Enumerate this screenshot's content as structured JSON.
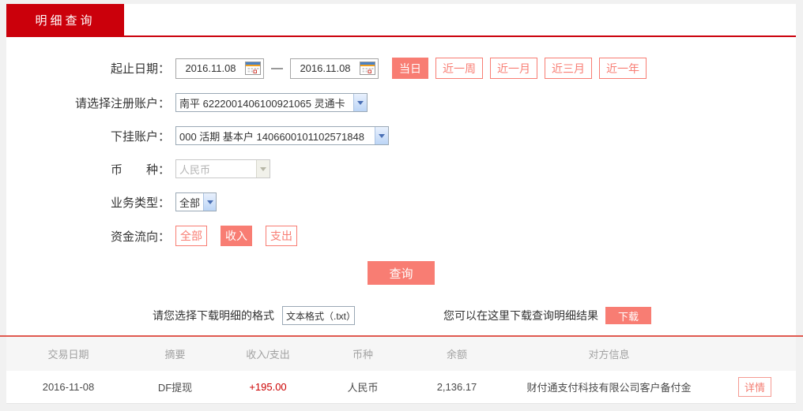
{
  "tab": {
    "label": "明细查询"
  },
  "form": {
    "date_range": {
      "label": "起止日期：",
      "start_value": "2016.11.08",
      "end_value": "2016.11.08",
      "separator": "—",
      "quick_ranges": [
        {
          "label": "当日",
          "selected": true
        },
        {
          "label": "近一周",
          "selected": false
        },
        {
          "label": "近一月",
          "selected": false
        },
        {
          "label": "近三月",
          "selected": false
        },
        {
          "label": "近一年",
          "selected": false
        }
      ]
    },
    "register_account": {
      "label": "请选择注册账户：",
      "selected_value": "南平 6222001406100921065 灵通卡"
    },
    "linked_account": {
      "label": "下挂账户：",
      "selected_value": "000 活期 基本户 1406600101102571848"
    },
    "currency": {
      "label": "币　　种：",
      "selected_value": "人民币",
      "disabled": true
    },
    "business_type": {
      "label": "业务类型：",
      "selected_value": "全部"
    },
    "fund_flow": {
      "label": "资金流向：",
      "options": [
        {
          "label": "全部",
          "selected": false
        },
        {
          "label": "收入",
          "selected": true
        },
        {
          "label": "支出",
          "selected": false
        }
      ]
    },
    "query_button_label": "查询"
  },
  "download": {
    "format_label": "请您选择下载明细的格式",
    "format_value": "文本格式（.txt）",
    "hint_text": "您可以在这里下载查询明细结果",
    "download_button_label": "下载"
  },
  "table": {
    "headers": [
      "交易日期",
      "摘要",
      "收入/支出",
      "币种",
      "余额",
      "对方信息"
    ],
    "rows": [
      {
        "trade_date": "2016-11-08",
        "summary": "DF提现",
        "amount": "+195.00",
        "currency": "人民币",
        "balance": "2,136.17",
        "counterparty": "财付通支付科技有限公司客户备付金",
        "action_label": "详情"
      }
    ]
  },
  "colors": {
    "brand_red": "#cb000b",
    "salmon": "#f87d73",
    "amount_red": "#cc0000",
    "separator_red": "#e05a50"
  }
}
